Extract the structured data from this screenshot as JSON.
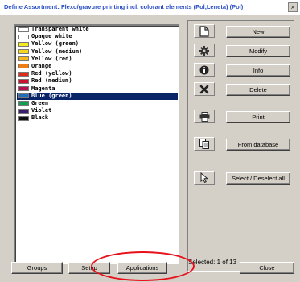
{
  "window": {
    "title": "Define Assortment: Flexo/gravure printing incl. colorant elements  (Pol,Leneta) (Pol)",
    "close_glyph": "×"
  },
  "colors": {
    "window_bg": "#d4d0c8",
    "title_text": "#2a4fc6",
    "selection_bg": "#0a246a",
    "annotation_red": "#e8101a"
  },
  "list": {
    "items": [
      {
        "label": "Transparent white",
        "swatch": "#ffffff",
        "selected": false
      },
      {
        "label": "Opaque white",
        "swatch": "#ffffff",
        "selected": false
      },
      {
        "label": "Yellow (green)",
        "swatch": "#f2ec1a",
        "selected": false
      },
      {
        "label": "Yellow (medium)",
        "swatch": "#f7d81c",
        "selected": false
      },
      {
        "label": "Yellow (red)",
        "swatch": "#f7b71c",
        "selected": false
      },
      {
        "label": "Orange",
        "swatch": "#f07c12",
        "selected": false
      },
      {
        "label": "Red (yellow)",
        "swatch": "#e02a1a",
        "selected": false
      },
      {
        "label": "Red (medium)",
        "swatch": "#cc1230",
        "selected": false
      },
      {
        "label": "Magenta",
        "swatch": "#b4124e",
        "selected": false
      },
      {
        "label": "Blue (green)",
        "swatch": "#1f6fb6",
        "selected": true
      },
      {
        "label": "Green",
        "swatch": "#139c52",
        "selected": false
      },
      {
        "label": "Violet",
        "swatch": "#3a1e6e",
        "selected": false
      },
      {
        "label": "Black",
        "swatch": "#111111",
        "selected": false
      }
    ]
  },
  "actions": {
    "new_label": "New",
    "new_icon": "new-document-icon",
    "modify_label": "Modify",
    "modify_icon": "gear-icon",
    "info_label": "Info",
    "info_icon": "info-icon",
    "delete_label": "Delete",
    "delete_icon": "delete-x-icon",
    "print_label": "Print",
    "print_icon": "printer-icon",
    "from_database_label": "From database",
    "from_database_icon": "copy-documents-icon",
    "select_deselect_label": "Select / Deselect all",
    "select_deselect_icon": "cursor-arrow-icon"
  },
  "status": {
    "selected_text": "Selected: 1 of 13"
  },
  "footer": {
    "groups_label": "Groups",
    "setup_label": "Setup",
    "applications_label": "Applications",
    "close_label": "Close"
  }
}
